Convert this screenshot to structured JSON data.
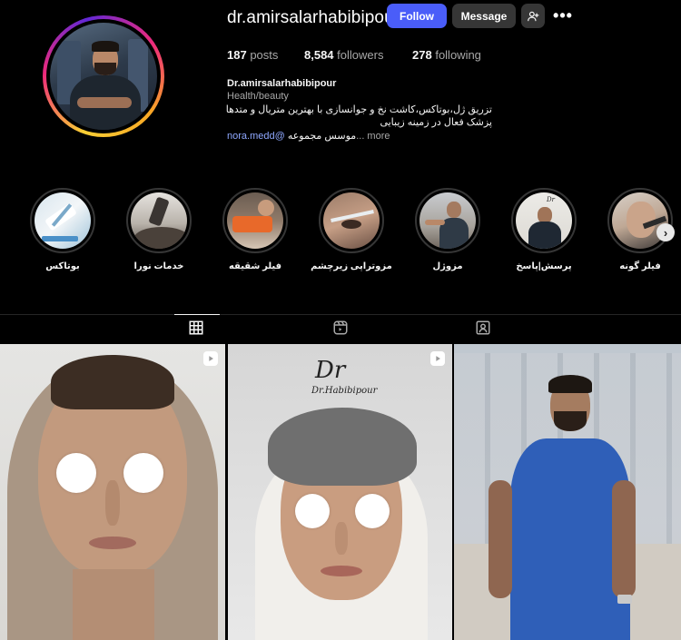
{
  "profile": {
    "username": "dr.amirsalarhabibipour",
    "follow_label": "Follow",
    "message_label": "Message",
    "more_label": "•••",
    "stats": {
      "posts_count": "187",
      "posts_label": "posts",
      "followers_count": "8,584",
      "followers_label": "followers",
      "following_count": "278",
      "following_label": "following"
    },
    "bio": {
      "name": "Dr.amirsalarhabibipour",
      "category": "Health/beauty",
      "line1": "تزریق ژل،بوتاکس،کاشت نخ و جوانسازی با بهترین متریال و متدها",
      "line2": "پزشک فعال در زمینه زیبایی",
      "mention": "nora.medd@",
      "line3": "موسس مجموعه",
      "more": "... more"
    }
  },
  "highlights": [
    {
      "label": "بوتاکس",
      "icon": "botox-highlight"
    },
    {
      "label": "خدمات نورا",
      "icon": "nora-services-highlight"
    },
    {
      "label": "فیلر شقیقه",
      "icon": "temple-filler-highlight"
    },
    {
      "label": "مزوتراپی زیرچشم",
      "icon": "under-eye-mesotherapy-highlight"
    },
    {
      "label": "مزوژل",
      "icon": "mesogel-highlight"
    },
    {
      "label": "پرسش|پاسخ",
      "icon": "qa-highlight"
    },
    {
      "label": "فیلر گونه",
      "icon": "cheek-filler-highlight"
    }
  ],
  "tabs": [
    {
      "name": "posts-grid",
      "icon": "grid-icon",
      "active": true
    },
    {
      "name": "reels",
      "icon": "reels-icon",
      "active": false
    },
    {
      "name": "tagged",
      "icon": "tagged-icon",
      "active": false
    }
  ],
  "posts": [
    {
      "type": "reel",
      "icon": "reel-badge-icon"
    },
    {
      "type": "reel",
      "icon": "reel-badge-icon",
      "watermark_sig": "Dr",
      "watermark_text": "Dr.Habibipour"
    },
    {
      "type": "image"
    }
  ],
  "colors": {
    "background": "#000000",
    "follow_button": "#4a5df9",
    "secondary_button": "#363636",
    "mention": "#8fa8ff",
    "muted_text": "#a8a8a8"
  }
}
